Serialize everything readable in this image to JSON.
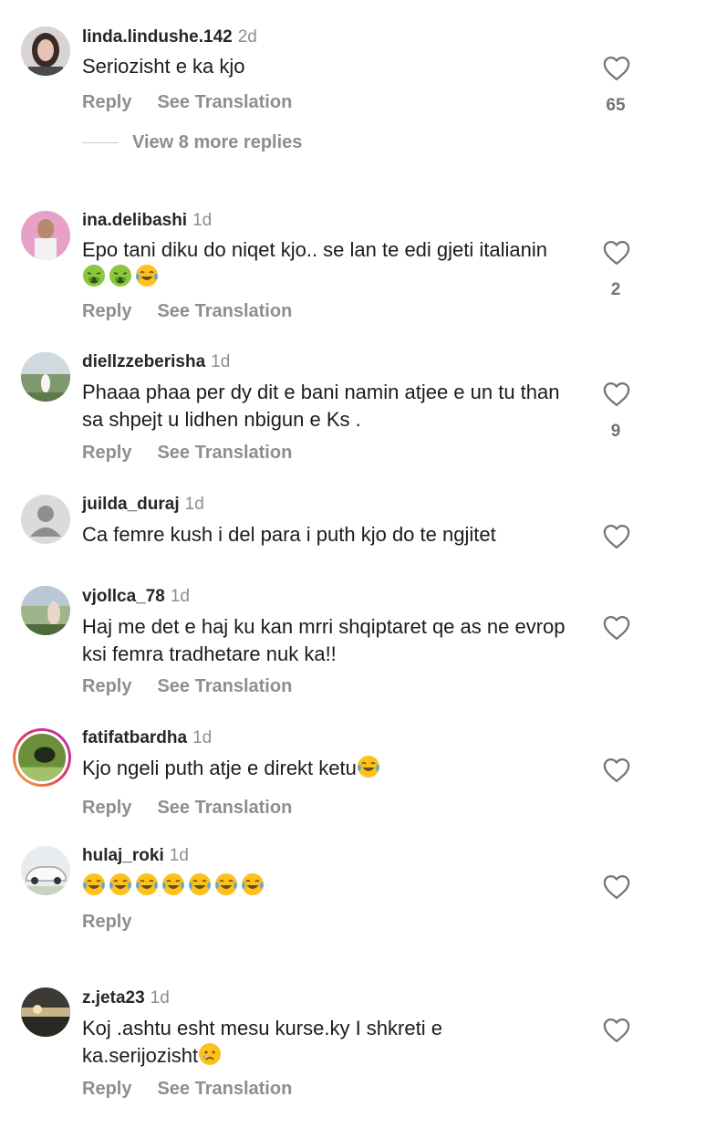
{
  "labels": {
    "reply": "Reply",
    "see_translation": "See Translation"
  },
  "comments": [
    {
      "username": "linda.lindushe.142",
      "time": "2d",
      "text": "Seriozisht e ka kjo",
      "likes": "65",
      "view_more": "View 8 more replies"
    },
    {
      "username": "ina.delibashi",
      "time": "1d",
      "text": "Epo tani diku do niqet kjo.. se lan te edi gjeti italianin",
      "likes": "2"
    },
    {
      "username": "diellzzeberisha",
      "time": "1d",
      "text": "Phaaa phaa per dy dit e bani namin atjee e un tu than sa shpejt u lidhen nbigun e Ks .",
      "likes": "9"
    },
    {
      "username": "juilda_duraj",
      "time": "1d",
      "text": "Ca femre kush i del para i puth kjo do te ngjitet"
    },
    {
      "username": "vjollca_78",
      "time": "1d",
      "text": "Haj me det e haj ku kan mrri shqiptaret qe as ne evrop ksi femra tradhetare nuk ka!!"
    },
    {
      "username": "fatifatbardha",
      "time": "1d",
      "text": "Kjo ngeli puth atje e direkt ketu"
    },
    {
      "username": "hulaj_roki",
      "time": "1d",
      "text": ""
    },
    {
      "username": "z.jeta23",
      "time": "1d",
      "text": "Koj .ashtu esht mesu kurse.ky I shkreti  e ka.serijozisht"
    }
  ],
  "icons": {
    "heart": "heart-outline-icon",
    "emoji_nauseated": "nauseated-face-emoji",
    "emoji_joy": "tears-of-joy-emoji",
    "emoji_cry": "crying-face-emoji"
  },
  "colors": {
    "secondary_text": "#8e8e8e",
    "primary_text": "#262626",
    "story_ring": "#e1306c"
  }
}
